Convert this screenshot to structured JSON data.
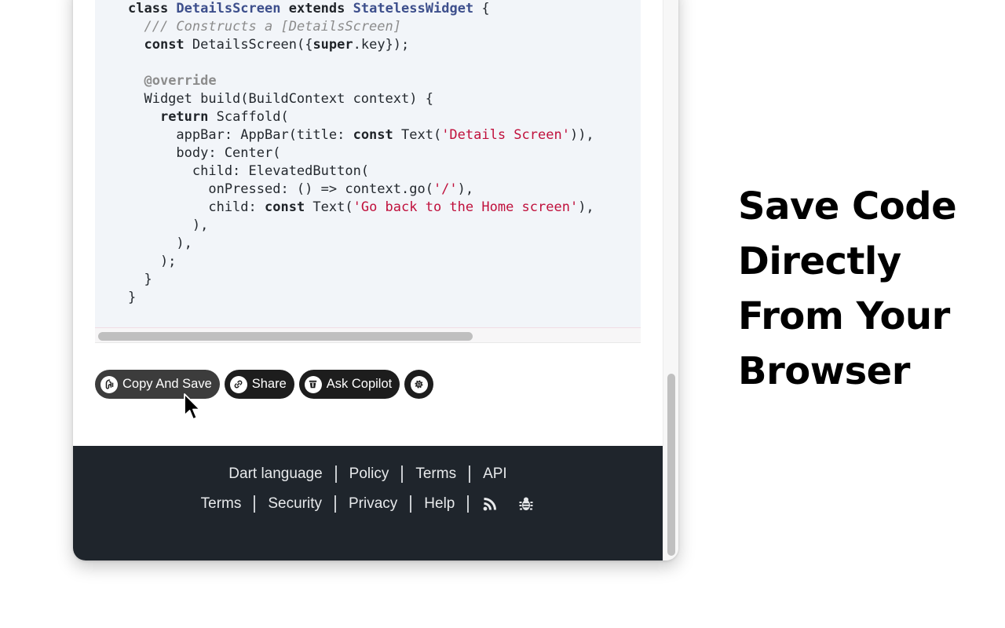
{
  "code": {
    "lines": [
      [
        {
          "t": "class ",
          "c": "kw"
        },
        {
          "t": "DetailsScreen",
          "c": "type"
        },
        {
          "t": " "
        },
        {
          "t": "extends",
          "c": "kw"
        },
        {
          "t": " "
        },
        {
          "t": "StatelessWidget",
          "c": "type"
        },
        {
          "t": " {"
        }
      ],
      [
        {
          "t": "  "
        },
        {
          "t": "/// Constructs a [DetailsScreen]",
          "c": "comment"
        }
      ],
      [
        {
          "t": "  "
        },
        {
          "t": "const",
          "c": "kw"
        },
        {
          "t": " DetailsScreen({"
        },
        {
          "t": "super",
          "c": "kw"
        },
        {
          "t": ".key});"
        }
      ],
      [
        {
          "t": ""
        }
      ],
      [
        {
          "t": "  "
        },
        {
          "t": "@override",
          "c": "meta"
        }
      ],
      [
        {
          "t": "  Widget build(BuildContext context) {"
        }
      ],
      [
        {
          "t": "    "
        },
        {
          "t": "return",
          "c": "kw"
        },
        {
          "t": " Scaffold("
        }
      ],
      [
        {
          "t": "      appBar: AppBar(title: "
        },
        {
          "t": "const",
          "c": "kw"
        },
        {
          "t": " Text("
        },
        {
          "t": "'Details Screen'",
          "c": "str"
        },
        {
          "t": ")),"
        }
      ],
      [
        {
          "t": "      body: Center("
        }
      ],
      [
        {
          "t": "        child: ElevatedButton("
        }
      ],
      [
        {
          "t": "          onPressed: () => context.go("
        },
        {
          "t": "'/'",
          "c": "str"
        },
        {
          "t": "),"
        }
      ],
      [
        {
          "t": "          child: "
        },
        {
          "t": "const",
          "c": "kw"
        },
        {
          "t": " Text("
        },
        {
          "t": "'Go back to the Home screen'",
          "c": "str"
        },
        {
          "t": "),"
        }
      ],
      [
        {
          "t": "        ),"
        }
      ],
      [
        {
          "t": "      ),"
        }
      ],
      [
        {
          "t": "    );"
        }
      ],
      [
        {
          "t": "  }"
        }
      ],
      [
        {
          "t": "}"
        }
      ]
    ]
  },
  "actions": {
    "copy_save": {
      "label": "Copy And Save",
      "icon": "pieces-logo-icon"
    },
    "share": {
      "label": "Share",
      "icon": "link-icon"
    },
    "ask_copilot": {
      "label": "Ask Copilot",
      "icon": "copilot-icon"
    },
    "settings": {
      "icon": "gear-icon"
    }
  },
  "footer": {
    "row1": [
      "Dart language",
      "Policy",
      "Terms",
      "API"
    ],
    "row2": [
      "Terms",
      "Security",
      "Privacy",
      "Help"
    ],
    "icons": [
      "rss-icon",
      "bug-icon"
    ]
  },
  "headline": {
    "lines": [
      "Save Code",
      "Directly",
      "From Your",
      "Browser"
    ]
  },
  "colors": {
    "code_bg": "#f2f5f9",
    "keyword": "#1f2328",
    "type": "#3d4f8c",
    "string": "#c0103c",
    "comment": "#8c8c8c",
    "pill_bg": "#1d1d1d",
    "footer_bg": "#1f252c"
  }
}
